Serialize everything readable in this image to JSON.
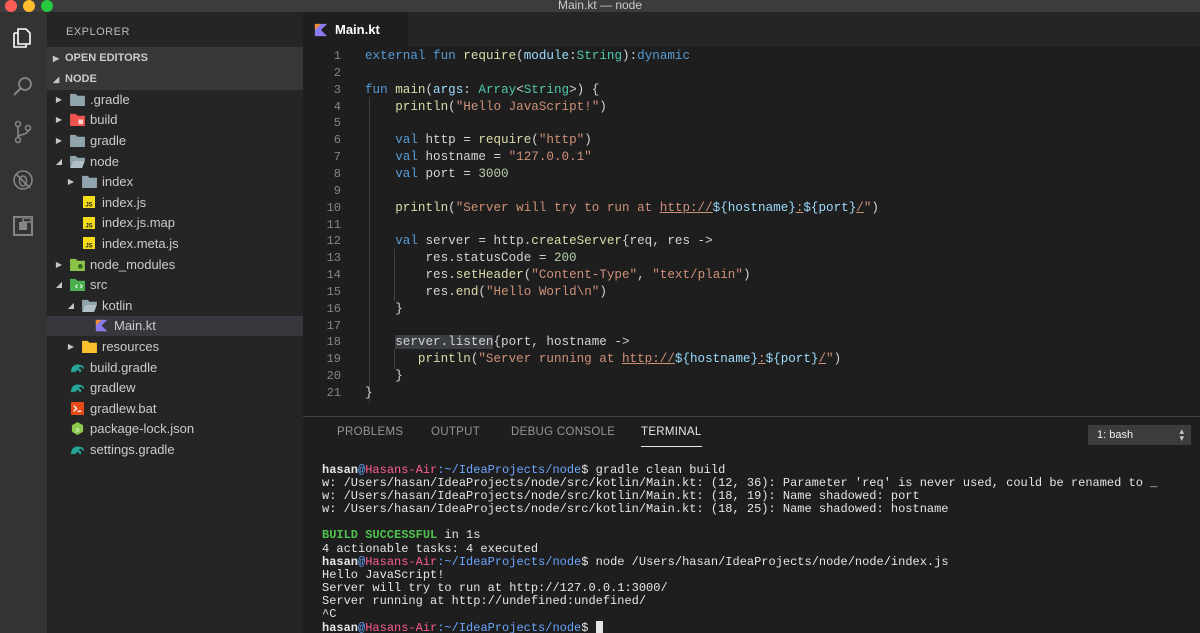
{
  "window": {
    "title": "Main.kt — node"
  },
  "activity_bar": [
    {
      "name": "explorer-icon"
    },
    {
      "name": "search-icon"
    },
    {
      "name": "source-control-icon"
    },
    {
      "name": "debug-icon"
    },
    {
      "name": "extensions-icon"
    }
  ],
  "sidebar": {
    "header": "EXPLORER",
    "open_editors": "OPEN EDITORS",
    "project": "NODE",
    "tree": [
      {
        "label": ".gradle",
        "depth": 1,
        "caret": "▶",
        "icon": "folder-icon",
        "selected": false
      },
      {
        "label": "build",
        "depth": 1,
        "caret": "▶",
        "icon": "folder-build-icon",
        "selected": false
      },
      {
        "label": "gradle",
        "depth": 1,
        "caret": "▶",
        "icon": "folder-icon",
        "selected": false
      },
      {
        "label": "node",
        "depth": 1,
        "caret": "◢",
        "icon": "folder-open-icon",
        "selected": false
      },
      {
        "label": "index",
        "depth": 2,
        "caret": "▶",
        "icon": "folder-icon",
        "selected": false
      },
      {
        "label": "index.js",
        "depth": 2,
        "caret": "",
        "icon": "js-file-icon",
        "selected": false
      },
      {
        "label": "index.js.map",
        "depth": 2,
        "caret": "",
        "icon": "js-file-icon",
        "selected": false
      },
      {
        "label": "index.meta.js",
        "depth": 2,
        "caret": "",
        "icon": "js-file-icon",
        "selected": false
      },
      {
        "label": "node_modules",
        "depth": 1,
        "caret": "▶",
        "icon": "folder-node-icon",
        "selected": false
      },
      {
        "label": "src",
        "depth": 1,
        "caret": "◢",
        "icon": "folder-src-icon",
        "selected": false
      },
      {
        "label": "kotlin",
        "depth": 2,
        "caret": "◢",
        "icon": "folder-open-icon",
        "selected": false
      },
      {
        "label": "Main.kt",
        "depth": 3,
        "caret": "",
        "icon": "kotlin-file-icon",
        "selected": true
      },
      {
        "label": "resources",
        "depth": 2,
        "caret": "▶",
        "icon": "folder-yellow-icon",
        "selected": false
      },
      {
        "label": "build.gradle",
        "depth": 1,
        "caret": "",
        "icon": "gradle-file-icon",
        "selected": false
      },
      {
        "label": "gradlew",
        "depth": 1,
        "caret": "",
        "icon": "gradle-file-icon",
        "selected": false
      },
      {
        "label": "gradlew.bat",
        "depth": 1,
        "caret": "",
        "icon": "bat-file-icon",
        "selected": false
      },
      {
        "label": "package-lock.json",
        "depth": 1,
        "caret": "",
        "icon": "npm-file-icon",
        "selected": false
      },
      {
        "label": "settings.gradle",
        "depth": 1,
        "caret": "",
        "icon": "gradle-file-icon",
        "selected": false
      }
    ]
  },
  "editor": {
    "tab_label": "Main.kt",
    "lines": [
      [
        [
          "external ",
          "kw"
        ],
        [
          "fun ",
          "kw"
        ],
        [
          "require",
          "fn"
        ],
        [
          "(",
          ""
        ],
        [
          "module",
          "var"
        ],
        [
          ":",
          ""
        ],
        [
          "String",
          "typ"
        ],
        [
          "):",
          ""
        ],
        [
          "dynamic",
          "kw"
        ]
      ],
      [],
      [
        [
          "fun ",
          "kw"
        ],
        [
          "main",
          "fn"
        ],
        [
          "(",
          ""
        ],
        [
          "args",
          "var"
        ],
        [
          ": ",
          ""
        ],
        [
          "Array",
          "typ"
        ],
        [
          "<",
          ""
        ],
        [
          "String",
          "typ"
        ],
        [
          ">) {",
          ""
        ]
      ],
      [
        [
          "    ",
          ""
        ],
        [
          "println",
          "fn"
        ],
        [
          "(",
          ""
        ],
        [
          "\"Hello JavaScript!\"",
          "str"
        ],
        [
          ")",
          ""
        ]
      ],
      [],
      [
        [
          "    ",
          ""
        ],
        [
          "val ",
          "kw"
        ],
        [
          "http = ",
          ""
        ],
        [
          "require",
          "fn"
        ],
        [
          "(",
          ""
        ],
        [
          "\"http\"",
          "str"
        ],
        [
          ")",
          ""
        ]
      ],
      [
        [
          "    ",
          ""
        ],
        [
          "val ",
          "kw"
        ],
        [
          "hostname = ",
          ""
        ],
        [
          "\"127.0.0.1\"",
          "str"
        ]
      ],
      [
        [
          "    ",
          ""
        ],
        [
          "val ",
          "kw"
        ],
        [
          "port = ",
          ""
        ],
        [
          "3000",
          "num"
        ]
      ],
      [],
      [
        [
          "    ",
          ""
        ],
        [
          "println",
          "fn"
        ],
        [
          "(",
          ""
        ],
        [
          "\"Server will try to run at ",
          "str"
        ],
        [
          "http://",
          "url"
        ],
        [
          "${hostname}",
          "var"
        ],
        [
          ":",
          "url"
        ],
        [
          "${port}",
          "var"
        ],
        [
          "/",
          "url"
        ],
        [
          "\"",
          "str"
        ],
        [
          ")",
          ""
        ]
      ],
      [],
      [
        [
          "    ",
          ""
        ],
        [
          "val ",
          "kw"
        ],
        [
          "server = http.",
          ""
        ],
        [
          "createServer",
          "fn"
        ],
        [
          "{req, res ->",
          ""
        ]
      ],
      [
        [
          "        res.statusCode = ",
          ""
        ],
        [
          "200",
          "num"
        ]
      ],
      [
        [
          "        res.",
          ""
        ],
        [
          "setHeader",
          "fn"
        ],
        [
          "(",
          ""
        ],
        [
          "\"Content-Type\"",
          "str"
        ],
        [
          ", ",
          ""
        ],
        [
          "\"text/plain\"",
          "str"
        ],
        [
          ")",
          ""
        ]
      ],
      [
        [
          "        res.",
          ""
        ],
        [
          "end",
          "fn"
        ],
        [
          "(",
          ""
        ],
        [
          "\"Hello World\\n\"",
          "str"
        ],
        [
          ")",
          ""
        ]
      ],
      [
        [
          "    }",
          ""
        ]
      ],
      [],
      [
        [
          "    ",
          ""
        ],
        [
          "server.listen",
          "hl"
        ],
        [
          "{port, hostname ->",
          ""
        ]
      ],
      [
        [
          "       ",
          ""
        ],
        [
          "println",
          "fn"
        ],
        [
          "(",
          ""
        ],
        [
          "\"Server running at ",
          "str"
        ],
        [
          "http://",
          "url"
        ],
        [
          "${hostname}",
          "var"
        ],
        [
          ":",
          "url"
        ],
        [
          "${port}",
          "var"
        ],
        [
          "/",
          "url"
        ],
        [
          "\"",
          "str"
        ],
        [
          ")",
          ""
        ]
      ],
      [
        [
          "    }",
          ""
        ]
      ],
      [
        [
          "}",
          ""
        ]
      ]
    ]
  },
  "panel": {
    "tabs": [
      "PROBLEMS",
      "OUTPUT",
      "DEBUG CONSOLE",
      "TERMINAL"
    ],
    "active_tab": "TERMINAL",
    "terminal_select": "1: bash",
    "terminal": [
      [
        [
          "hasan",
          "pu"
        ],
        [
          "@",
          "pp"
        ],
        [
          "Hasans-Air",
          "ph"
        ],
        [
          ":~/IdeaProjects/node",
          "pp"
        ],
        [
          "$ gradle clean build",
          ""
        ]
      ],
      [
        [
          "w: /Users/hasan/IdeaProjects/node/src/kotlin/Main.kt: (12, 36): Parameter 'req' is never used, could be renamed to _",
          ""
        ]
      ],
      [
        [
          "w: /Users/hasan/IdeaProjects/node/src/kotlin/Main.kt: (18, 19): Name shadowed: port",
          ""
        ]
      ],
      [
        [
          "w: /Users/hasan/IdeaProjects/node/src/kotlin/Main.kt: (18, 25): Name shadowed: hostname",
          ""
        ]
      ],
      [],
      [
        [
          "BUILD SUCCESSFUL",
          "ok"
        ],
        [
          " in 1s",
          ""
        ]
      ],
      [
        [
          "4 actionable tasks: 4 executed",
          ""
        ]
      ],
      [
        [
          "hasan",
          "pu"
        ],
        [
          "@",
          "pp"
        ],
        [
          "Hasans-Air",
          "ph"
        ],
        [
          ":~/IdeaProjects/node",
          "pp"
        ],
        [
          "$ node /Users/hasan/IdeaProjects/node/node/index.js",
          ""
        ]
      ],
      [
        [
          "Hello JavaScript!",
          ""
        ]
      ],
      [
        [
          "Server will try to run at http://127.0.0.1:3000/",
          ""
        ]
      ],
      [
        [
          "Server running at http://undefined:undefined/",
          ""
        ]
      ],
      [
        [
          "^C",
          ""
        ]
      ],
      [
        [
          "hasan",
          "pu"
        ],
        [
          "@",
          "pp"
        ],
        [
          "Hasans-Air",
          "ph"
        ],
        [
          ":~/IdeaProjects/node",
          "pp"
        ],
        [
          "$ ",
          ""
        ]
      ]
    ]
  }
}
